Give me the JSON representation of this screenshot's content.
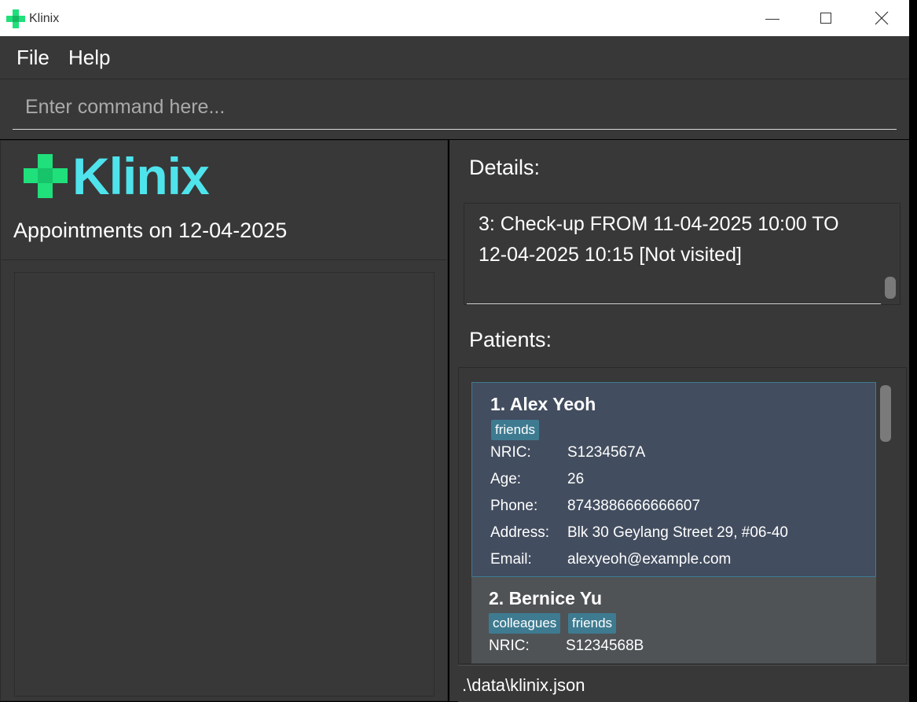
{
  "window": {
    "title": "Klinix",
    "min_icon": "minimize-icon",
    "max_icon": "maximize-icon",
    "close_icon": "close-icon"
  },
  "menu": {
    "file": "File",
    "help": "Help"
  },
  "command": {
    "placeholder": "Enter command here..."
  },
  "logo": {
    "text": "Klinix",
    "icon": "medical-cross-icon",
    "color": "#4fe3ec",
    "cross_color": "#1fe07a"
  },
  "appointments": {
    "title": "Appointments on 12-04-2025"
  },
  "details": {
    "label": "Details:",
    "text": "3: Check-up FROM 11-04-2025 10:00 TO 12-04-2025 10:15 [Not visited]"
  },
  "patients": {
    "label": "Patients:",
    "field_labels": {
      "nric": "NRIC:",
      "age": "Age:",
      "phone": "Phone:",
      "address": "Address:",
      "email": "Email:"
    },
    "items": [
      {
        "name": "1. Alex Yeoh",
        "tags": [
          "friends"
        ],
        "nric": "S1234567A",
        "age": "26",
        "phone": "8743886666666607",
        "address": "Blk 30 Geylang Street 29, #06-40",
        "email": "alexyeoh@example.com"
      },
      {
        "name": "2. Bernice Yu",
        "tags": [
          "colleagues",
          "friends"
        ],
        "nric": "S1234568B"
      }
    ]
  },
  "status": {
    "path": ".\\data\\klinix.json"
  },
  "colors": {
    "background": "#383838",
    "selected_card": "#424d5f",
    "tag": "#3e7b91"
  }
}
